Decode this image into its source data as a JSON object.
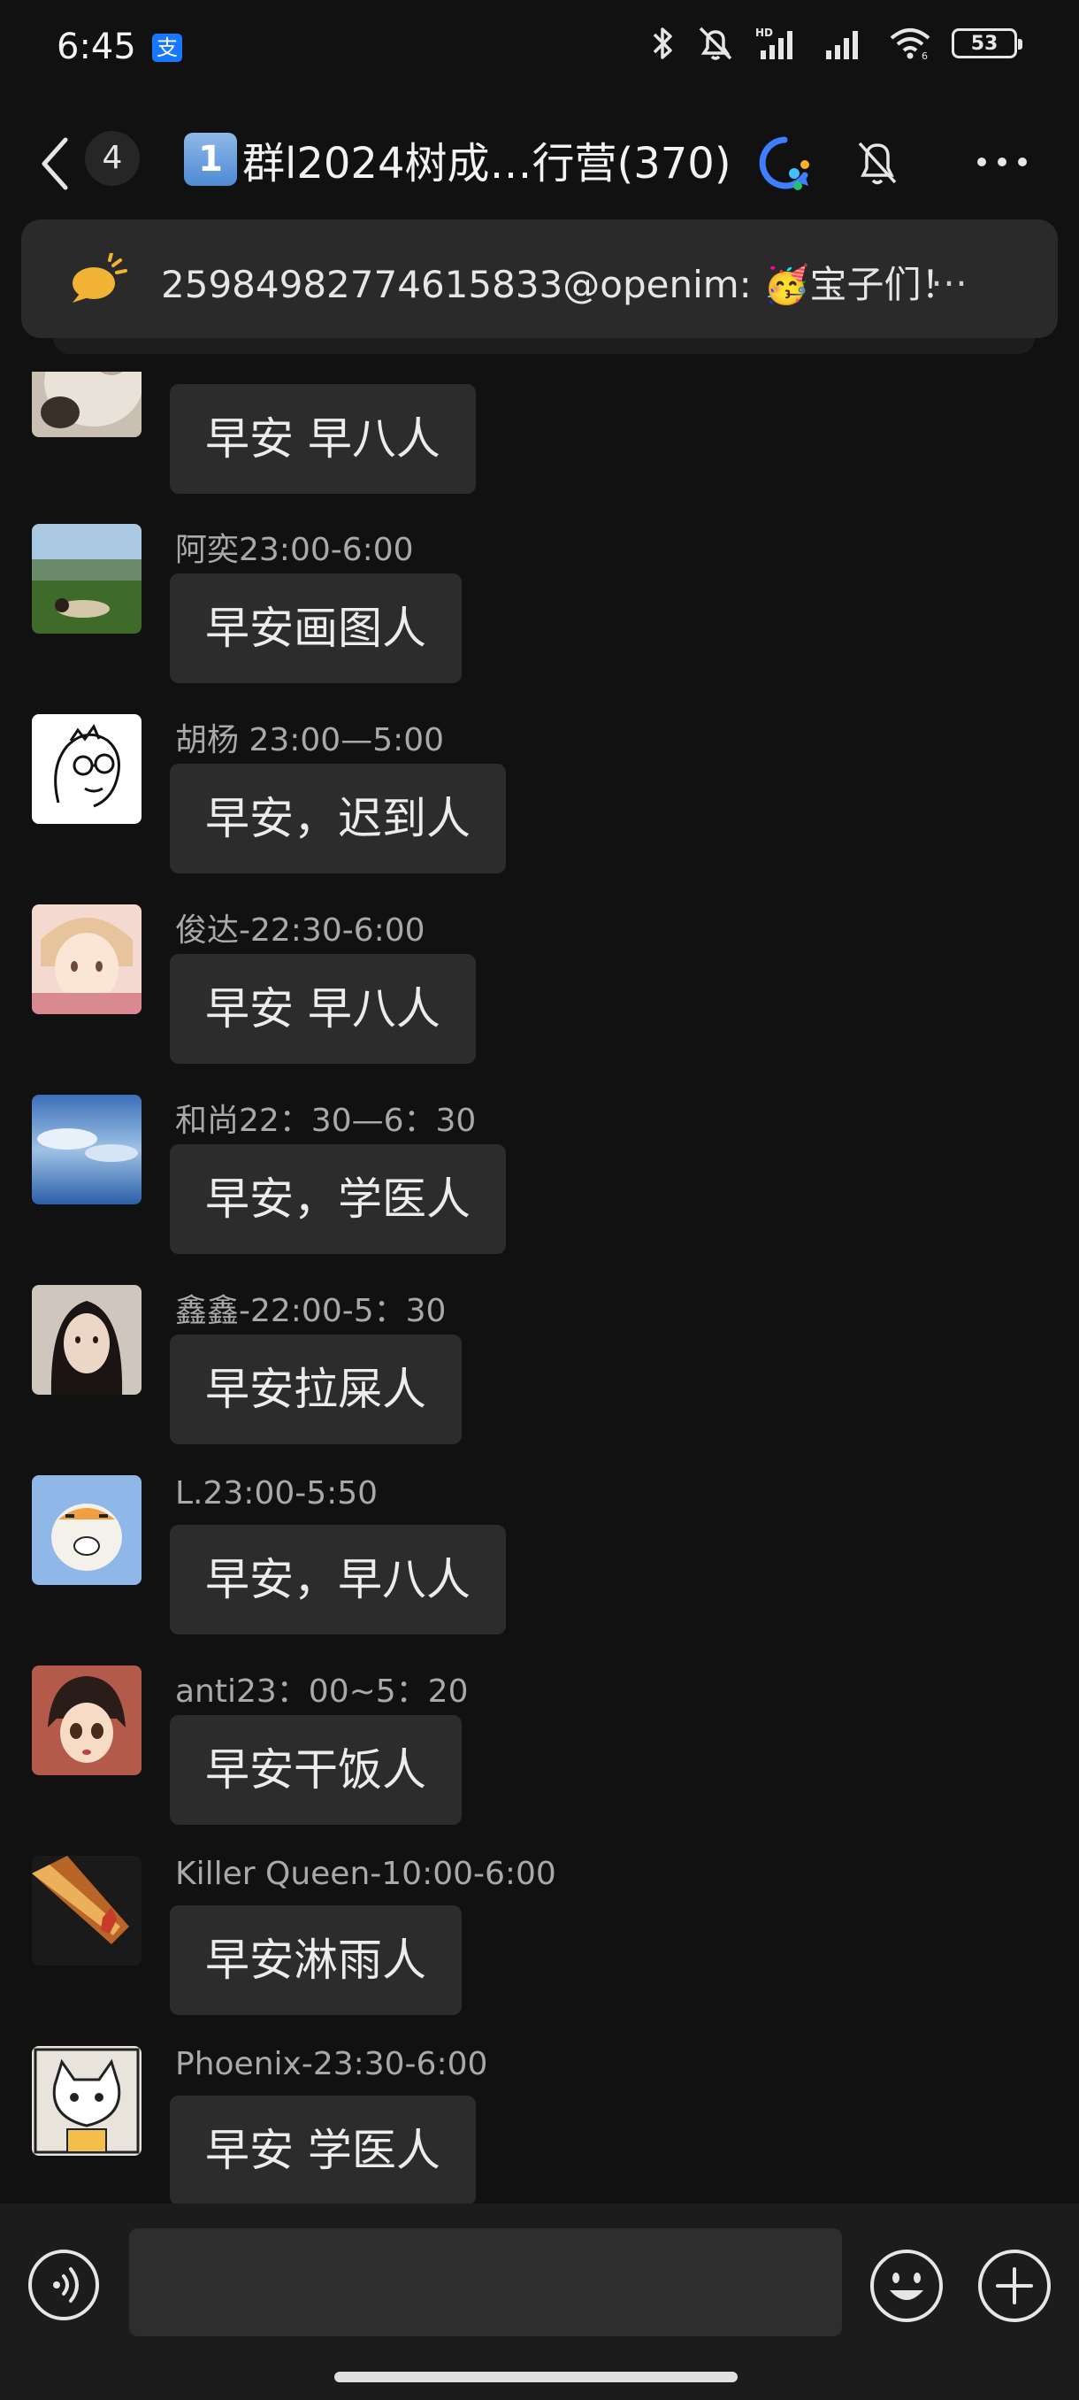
{
  "status_bar": {
    "time": "6:45",
    "alipay_glyph": "支",
    "battery": "53",
    "icons": [
      "bluetooth-icon",
      "mute-icon",
      "signal-icon",
      "wifi-icon",
      "battery-icon"
    ]
  },
  "header": {
    "unread_count": "4",
    "title_badge": "1",
    "title": "群l2024树成…行营(370)",
    "icons": [
      "back-chevron-icon",
      "ai-assistant-icon",
      "bell-off-icon",
      "more-dots-icon"
    ]
  },
  "pinned": {
    "sender": "25984982774615833@openim:",
    "emoji": "🥳",
    "text": "宝子们！",
    "ellipsis": "…",
    "icon": "announcement-icon"
  },
  "messages": [
    {
      "sender": "",
      "text": "早安 早八人",
      "avatar": "cat-photo"
    },
    {
      "sender": "阿奕23:00-6:00",
      "text": "早安画图人",
      "avatar": "landscape-photo"
    },
    {
      "sender": "胡杨 23:00—5:00",
      "text": "早安，迟到人",
      "avatar": "sketch-face"
    },
    {
      "sender": "俊达-22:30-6:00",
      "text": "早安 早八人",
      "avatar": "anime-boy"
    },
    {
      "sender": "和尚22：30—6：30",
      "text": "早安，学医人",
      "avatar": "sky-painting"
    },
    {
      "sender": "鑫鑫-22:00-5：30",
      "text": "早安拉屎人",
      "avatar": "girl-photo"
    },
    {
      "sender": "L.23:00-5:50",
      "text": "早安，早八人",
      "avatar": "tiger-cartoon"
    },
    {
      "sender": "anti23：00~5：20",
      "text": "早安干饭人",
      "avatar": "anime-girl"
    },
    {
      "sender": "Killer Queen-10:00-6:00",
      "text": "早安淋雨人",
      "avatar": "dancer-spotlight"
    },
    {
      "sender": "Phoenix-23:30-6:00",
      "text": "早安 学医人",
      "avatar": "cat-cartoon"
    }
  ],
  "input_bar": {
    "placeholder": "",
    "icons": [
      "voice-icon",
      "emoji-icon",
      "plus-icon"
    ]
  }
}
